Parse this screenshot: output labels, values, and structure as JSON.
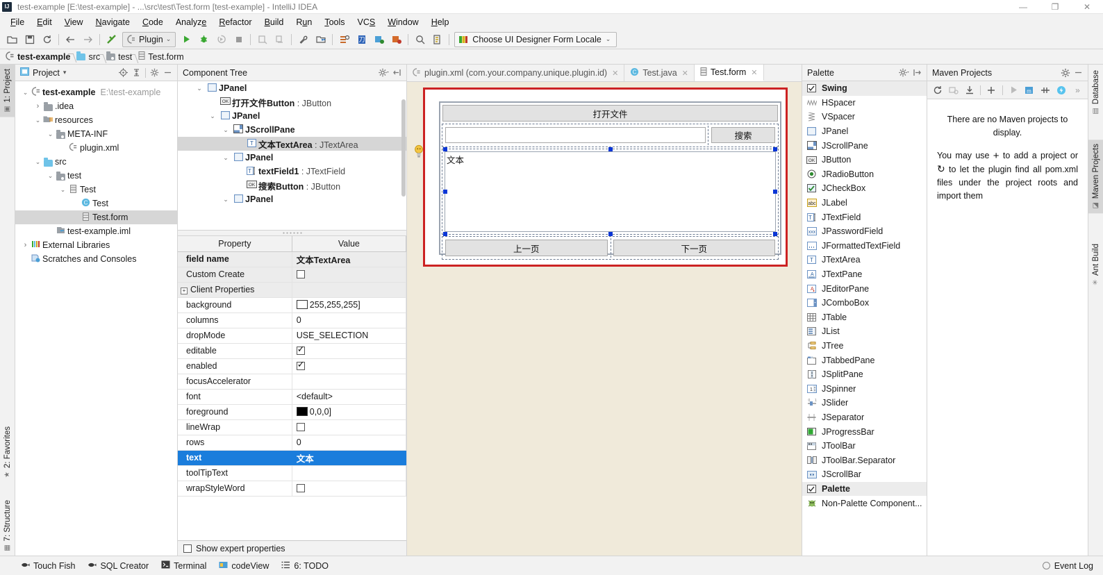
{
  "window": {
    "title": "test-example [E:\\test-example] - ...\\src\\test\\Test.form [test-example] - IntelliJ IDEA",
    "logo": "IJ",
    "minimize": "—",
    "restore": "❐",
    "close": "✕"
  },
  "menu": {
    "items": [
      {
        "label": "File"
      },
      {
        "label": "Edit"
      },
      {
        "label": "View"
      },
      {
        "label": "Navigate"
      },
      {
        "label": "Code"
      },
      {
        "label": "Analyze"
      },
      {
        "label": "Refactor"
      },
      {
        "label": "Build"
      },
      {
        "label": "Run"
      },
      {
        "label": "Tools"
      },
      {
        "label": "VCS"
      },
      {
        "label": "Window"
      },
      {
        "label": "Help"
      }
    ]
  },
  "toolbar": {
    "run_config": "Plugin",
    "locale_combo": "Choose UI Designer Form Locale",
    "icons": [
      "open-folder-icon",
      "save-icon",
      "sync-icon",
      "back-arrow-icon",
      "forward-arrow-icon",
      "build-icon",
      "run-icon",
      "debug-icon",
      "run-coverage-icon",
      "stop-icon",
      "profile-icon",
      "attach-icon",
      "settings-wrench-icon",
      "project-structure-icon",
      "search-structure-icon",
      "translate-icon",
      "git-update-icon",
      "git-commit-icon",
      "search-everywhere-icon",
      "reformat-icon"
    ]
  },
  "breadcrumb": {
    "items": [
      {
        "label": "test-example",
        "icon": "plugin-module-icon"
      },
      {
        "label": "src",
        "icon": "source-folder-icon"
      },
      {
        "label": "test",
        "icon": "package-folder-icon"
      },
      {
        "label": "Test.form",
        "icon": "form-file-icon"
      }
    ]
  },
  "left_rail": {
    "tabs": [
      {
        "label": "1: Project",
        "icon": "project-icon",
        "active": true
      },
      {
        "label": "2: Favorites",
        "icon": "star-icon",
        "active": false
      },
      {
        "label": "7: Structure",
        "icon": "structure-icon",
        "active": false
      }
    ]
  },
  "right_rail": {
    "tabs": [
      {
        "label": "Database",
        "icon": "database-icon"
      },
      {
        "label": "Maven Projects",
        "icon": "maven-icon",
        "active": true
      },
      {
        "label": "Ant Build",
        "icon": "ant-icon"
      }
    ]
  },
  "project_panel": {
    "title": "Project",
    "title_caret": "▾",
    "header_icons": [
      "locate-icon",
      "collapse-all-icon",
      "gear-icon",
      "hide-icon"
    ],
    "tree": [
      {
        "label": "test-example",
        "sub": "E:\\test-example",
        "arrow": "⌄",
        "icon": "module-icon",
        "indent": 0,
        "bold": true
      },
      {
        "label": ".idea",
        "arrow": "›",
        "icon": "folder-gray-icon",
        "indent": 1
      },
      {
        "label": "resources",
        "arrow": "⌄",
        "icon": "resource-folder-icon",
        "indent": 1
      },
      {
        "label": "META-INF",
        "arrow": "⌄",
        "icon": "folder-gray-dot-icon",
        "indent": 2
      },
      {
        "label": "plugin.xml",
        "arrow": "",
        "icon": "plugin-xml-icon",
        "indent": 3
      },
      {
        "label": "src",
        "arrow": "⌄",
        "icon": "folder-blue-icon",
        "indent": 1
      },
      {
        "label": "test",
        "arrow": "⌄",
        "icon": "folder-gray-dot-icon",
        "indent": 2
      },
      {
        "label": "Test",
        "arrow": "⌄",
        "icon": "file-icon",
        "indent": 3
      },
      {
        "label": "Test",
        "arrow": "",
        "icon": "class-icon",
        "indent": 4
      },
      {
        "label": "Test.form",
        "arrow": "",
        "icon": "form-file-icon",
        "indent": 4,
        "selected": true
      },
      {
        "label": "test-example.iml",
        "arrow": "",
        "icon": "iml-icon",
        "indent": 2
      },
      {
        "label": "External Libraries",
        "arrow": "›",
        "icon": "library-icon",
        "indent": 0
      },
      {
        "label": "Scratches and Consoles",
        "arrow": "",
        "icon": "scratches-icon",
        "indent": 0
      }
    ]
  },
  "component_tree": {
    "title": "Component Tree",
    "header_icons": [
      "gear-dropdown-icon",
      "collapse-icon"
    ],
    "nodes": [
      {
        "arrow": "⌄",
        "icon": "jpanel-icon",
        "name": "JPanel",
        "type": "",
        "indent": 1
      },
      {
        "arrow": "",
        "icon": "jbutton-icon",
        "name": "打开文件Button",
        "type": " : JButton",
        "indent": 2
      },
      {
        "arrow": "⌄",
        "icon": "jpanel-icon",
        "name": "JPanel",
        "type": "",
        "indent": 2
      },
      {
        "arrow": "⌄",
        "icon": "jscrollpane-icon",
        "name": "JScrollPane",
        "type": "",
        "indent": 3
      },
      {
        "arrow": "",
        "icon": "jtextarea-icon",
        "name": "文本TextArea",
        "type": " : JTextArea",
        "indent": 4,
        "selected": true
      },
      {
        "arrow": "⌄",
        "icon": "jpanel-icon",
        "name": "JPanel",
        "type": "",
        "indent": 3
      },
      {
        "arrow": "",
        "icon": "jtextfield-icon",
        "name": "textField1",
        "type": " : JTextField",
        "indent": 4
      },
      {
        "arrow": "",
        "icon": "jbutton-icon",
        "name": "搜索Button",
        "type": " : JButton",
        "indent": 4
      },
      {
        "arrow": "⌄",
        "icon": "jpanel-icon",
        "name": "JPanel",
        "type": "",
        "indent": 3
      }
    ]
  },
  "properties": {
    "col_property": "Property",
    "col_value": "Value",
    "expert_checkbox_label": "Show expert properties",
    "rows": [
      {
        "name": "field name",
        "value": "文本TextArea",
        "kind": "text",
        "bold": true,
        "shaded": true
      },
      {
        "name": "Custom Create",
        "value": "",
        "kind": "checkbox",
        "checked": false,
        "shaded": true
      },
      {
        "name": "Client Properties",
        "value": "",
        "kind": "expander",
        "shaded": true
      },
      {
        "name": "background",
        "value": "255,255,255]",
        "kind": "color",
        "color": "#ffffff"
      },
      {
        "name": "columns",
        "value": "0",
        "kind": "text"
      },
      {
        "name": "dropMode",
        "value": "USE_SELECTION",
        "kind": "text"
      },
      {
        "name": "editable",
        "value": "",
        "kind": "checkbox",
        "checked": true
      },
      {
        "name": "enabled",
        "value": "",
        "kind": "checkbox",
        "checked": true
      },
      {
        "name": "focusAccelerator",
        "value": "",
        "kind": "text"
      },
      {
        "name": "font",
        "value": "<default>",
        "kind": "text"
      },
      {
        "name": "foreground",
        "value": "0,0,0]",
        "kind": "color",
        "color": "#000000"
      },
      {
        "name": "lineWrap",
        "value": "",
        "kind": "checkbox",
        "checked": false
      },
      {
        "name": "rows",
        "value": "0",
        "kind": "text"
      },
      {
        "name": "text",
        "value": "文本",
        "kind": "text",
        "selected": true,
        "bold": true
      },
      {
        "name": "toolTipText",
        "value": "",
        "kind": "text"
      },
      {
        "name": "wrapStyleWord",
        "value": "",
        "kind": "checkbox",
        "checked": false
      }
    ]
  },
  "editor_tabs": [
    {
      "label": "plugin.xml (com.your.company.unique.plugin.id)",
      "icon": "plugin-xml-icon",
      "active": false,
      "close": "✕"
    },
    {
      "label": "Test.java",
      "icon": "class-icon",
      "active": false,
      "close": "✕"
    },
    {
      "label": "Test.form",
      "icon": "form-file-icon",
      "active": true,
      "close": "✕"
    }
  ],
  "designer": {
    "open_file_button": "打开文件",
    "search_field_value": "",
    "search_button": "搜索",
    "textarea_text": "文本",
    "prev_page_button": "上一页",
    "next_page_button": "下一页",
    "selection_color": "#0a36d6",
    "frame_border_color": "#cc2222",
    "canvas_bg": "#f0eada"
  },
  "palette": {
    "title": "Palette",
    "header_icons": [
      "gear-dropdown-icon",
      "hide-right-icon"
    ],
    "items": [
      {
        "label": "Swing",
        "icon": "group-checkbox-icon",
        "group": true
      },
      {
        "label": "HSpacer",
        "icon": "hspacer-icon"
      },
      {
        "label": "VSpacer",
        "icon": "vspacer-icon"
      },
      {
        "label": "JPanel",
        "icon": "jpanel-icon"
      },
      {
        "label": "JScrollPane",
        "icon": "jscrollpane-icon"
      },
      {
        "label": "JButton",
        "icon": "jbutton-icon"
      },
      {
        "label": "JRadioButton",
        "icon": "jradiobutton-icon"
      },
      {
        "label": "JCheckBox",
        "icon": "jcheckbox-icon"
      },
      {
        "label": "JLabel",
        "icon": "jlabel-icon"
      },
      {
        "label": "JTextField",
        "icon": "jtextfield-icon"
      },
      {
        "label": "JPasswordField",
        "icon": "jpasswordfield-icon"
      },
      {
        "label": "JFormattedTextField",
        "icon": "jformattedtextfield-icon"
      },
      {
        "label": "JTextArea",
        "icon": "jtextarea-icon"
      },
      {
        "label": "JTextPane",
        "icon": "jtextpane-icon"
      },
      {
        "label": "JEditorPane",
        "icon": "jeditorpane-icon"
      },
      {
        "label": "JComboBox",
        "icon": "jcombobox-icon"
      },
      {
        "label": "JTable",
        "icon": "jtable-icon"
      },
      {
        "label": "JList",
        "icon": "jlist-icon"
      },
      {
        "label": "JTree",
        "icon": "jtree-icon"
      },
      {
        "label": "JTabbedPane",
        "icon": "jtabbedpane-icon"
      },
      {
        "label": "JSplitPane",
        "icon": "jsplitpane-icon"
      },
      {
        "label": "JSpinner",
        "icon": "jspinner-icon"
      },
      {
        "label": "JSlider",
        "icon": "jslider-icon"
      },
      {
        "label": "JSeparator",
        "icon": "jseparator-icon"
      },
      {
        "label": "JProgressBar",
        "icon": "jprogressbar-icon"
      },
      {
        "label": "JToolBar",
        "icon": "jtoolbar-icon"
      },
      {
        "label": "JToolBar.Separator",
        "icon": "jtoolbar-separator-icon"
      },
      {
        "label": "JScrollBar",
        "icon": "jscrollbar-icon"
      },
      {
        "label": "Palette",
        "icon": "group-checkbox-icon",
        "group": true
      },
      {
        "label": "Non-Palette Component...",
        "icon": "non-palette-icon"
      }
    ]
  },
  "maven": {
    "title": "Maven Projects",
    "header_icons": [
      "gear-icon",
      "hide-icon"
    ],
    "toolbar_icons": [
      "reimport-icon",
      "generate-sources-icon",
      "download-sources-icon",
      "add-icon",
      "run-icon",
      "execute-goal-icon",
      "toggle-skip-tests-icon",
      "toggle-offline-icon",
      "more-icon"
    ],
    "empty_line1": "There are no Maven projects to display.",
    "empty_line2_a": "You may use",
    "empty_line2_plus": "+",
    "empty_line2_b": "to add a project or",
    "empty_line2_refresh": "↻",
    "empty_line2_c": "to let the plugin find all pom.xml files under the project roots and import them"
  },
  "status_bar": {
    "items": [
      {
        "label": "Touch Fish",
        "icon": "fish-icon"
      },
      {
        "label": "SQL Creator",
        "icon": "fish-icon"
      },
      {
        "label": "Terminal",
        "icon": "terminal-icon"
      },
      {
        "label": "codeView",
        "icon": "codeview-icon"
      },
      {
        "label": "6: TODO",
        "icon": "todo-icon"
      }
    ],
    "event_log": "Event Log"
  }
}
